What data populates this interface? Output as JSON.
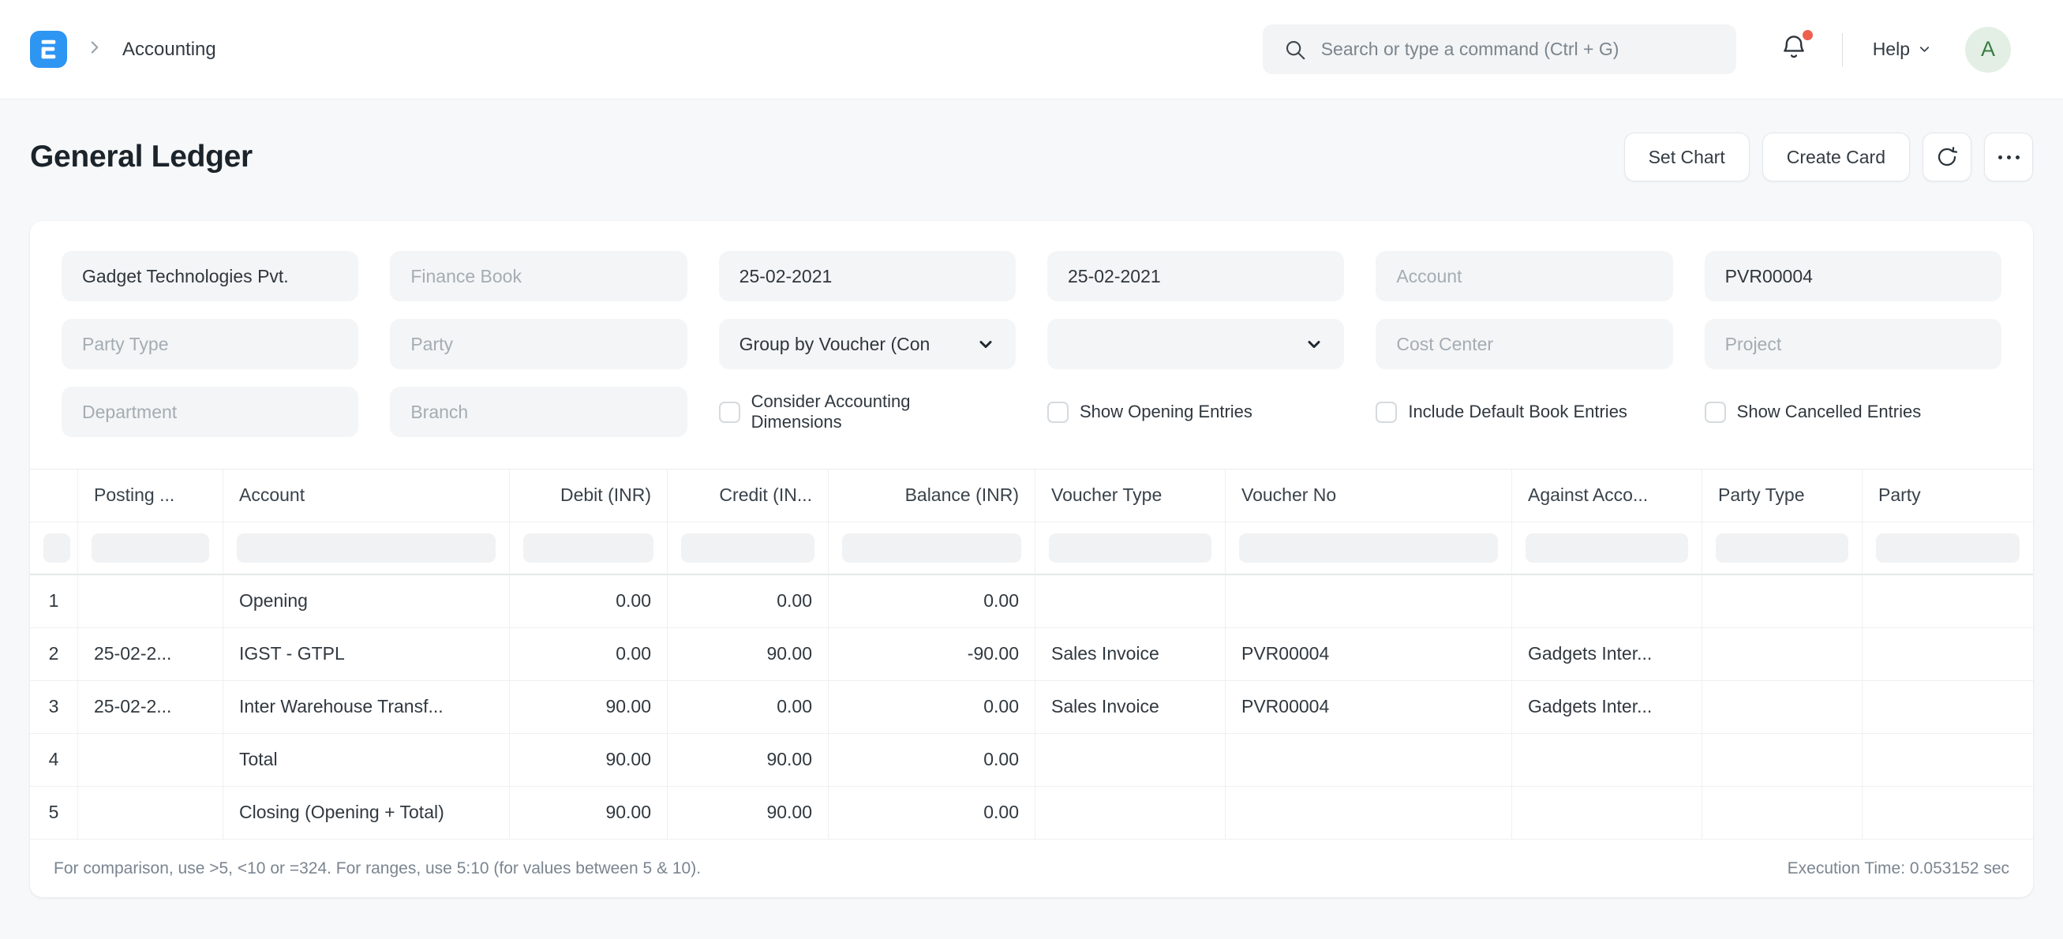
{
  "navbar": {
    "breadcrumb": "Accounting",
    "search_placeholder": "Search or type a command (Ctrl + G)",
    "help_label": "Help",
    "avatar_letter": "A"
  },
  "page": {
    "title": "General Ledger",
    "set_chart_label": "Set Chart",
    "create_card_label": "Create Card"
  },
  "filters": {
    "company_value": "Gadget Technologies Pvt.",
    "finance_book_placeholder": "Finance Book",
    "from_date_value": "25-02-2021",
    "to_date_value": "25-02-2021",
    "account_placeholder": "Account",
    "voucher_no_value": "PVR00004",
    "party_type_placeholder": "Party Type",
    "party_placeholder": "Party",
    "group_by_value": "Group by Voucher (Con",
    "cost_center_placeholder": "Cost Center",
    "project_placeholder": "Project",
    "department_placeholder": "Department",
    "branch_placeholder": "Branch",
    "checkboxes": [
      "Consider Accounting Dimensions",
      "Show Opening Entries",
      "Include Default Book Entries",
      "Show Cancelled Entries"
    ]
  },
  "table": {
    "headers": [
      "",
      "Posting ...",
      "Account",
      "Debit (INR)",
      "Credit (IN...",
      "Balance (INR)",
      "Voucher Type",
      "Voucher No",
      "Against Acco...",
      "Party Type",
      "Party"
    ],
    "rows": [
      [
        "1",
        "",
        "Opening",
        "0.00",
        "0.00",
        "0.00",
        "",
        "",
        "",
        "",
        ""
      ],
      [
        "2",
        "25-02-2...",
        "IGST - GTPL",
        "0.00",
        "90.00",
        "-90.00",
        "Sales Invoice",
        "PVR00004",
        "Gadgets Inter...",
        "",
        ""
      ],
      [
        "3",
        "25-02-2...",
        "Inter Warehouse Transf...",
        "90.00",
        "0.00",
        "0.00",
        "Sales Invoice",
        "PVR00004",
        "Gadgets Inter...",
        "",
        ""
      ],
      [
        "4",
        "",
        "Total",
        "90.00",
        "90.00",
        "0.00",
        "",
        "",
        "",
        "",
        ""
      ],
      [
        "5",
        "",
        "Closing (Opening + Total)",
        "90.00",
        "90.00",
        "0.00",
        "",
        "",
        "",
        "",
        ""
      ]
    ]
  },
  "footer": {
    "hint": "For comparison, use >5, <10 or =324. For ranges, use 5:10 (for values between 5 & 10).",
    "execution_time": "Execution Time: 0.053152 sec"
  },
  "colors": {
    "brand_blue": "#2d95f2",
    "notification_dot": "#ef5f4e",
    "avatar_bg": "#e3efe4",
    "avatar_text": "#3c7c44"
  }
}
